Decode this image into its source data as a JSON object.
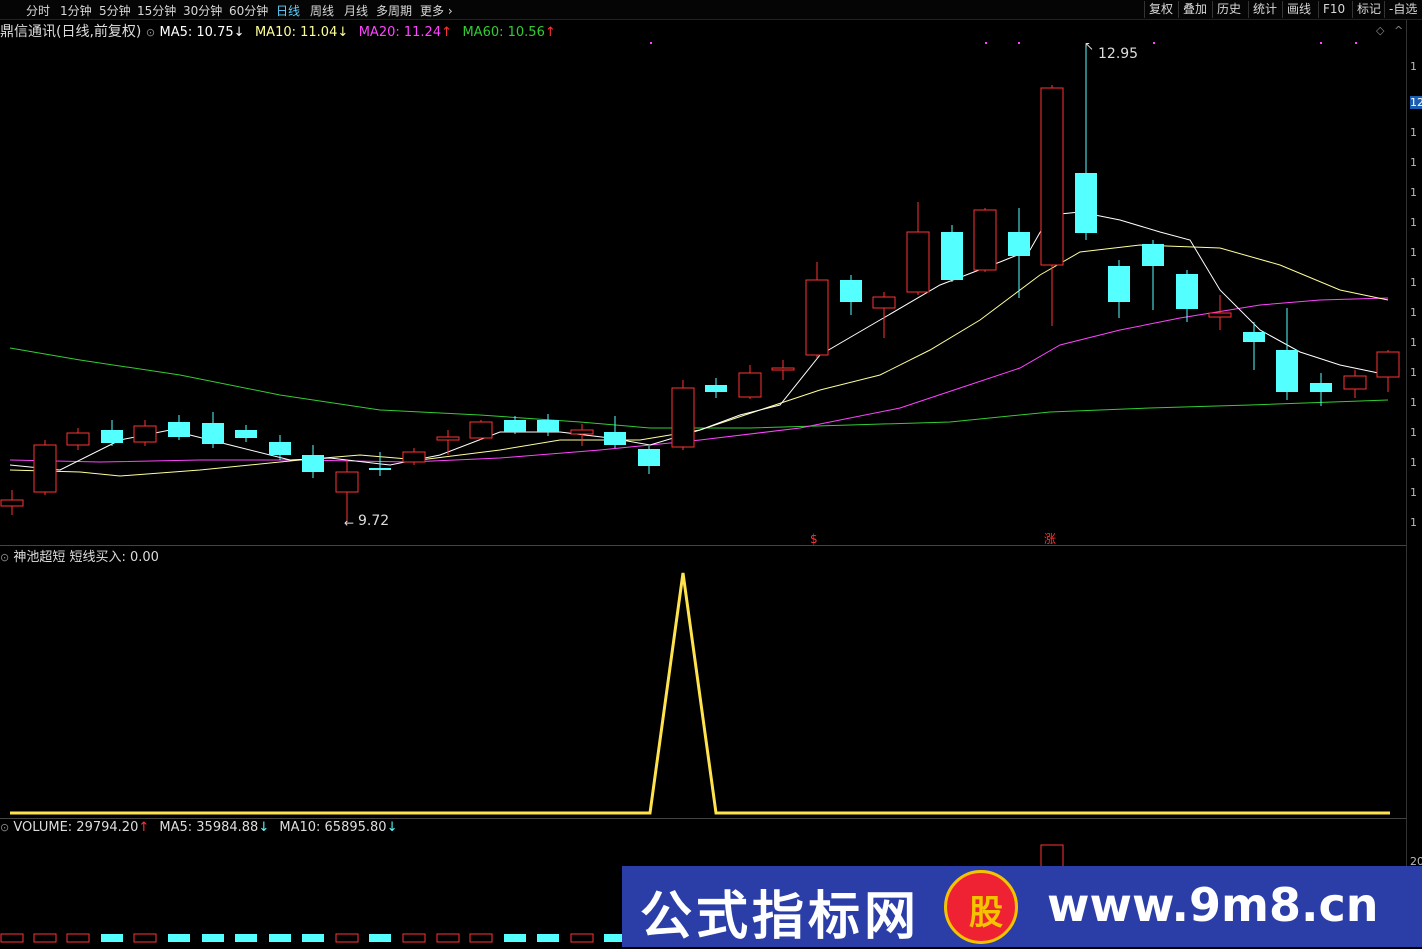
{
  "toolbar": {
    "tabs": [
      "分时",
      "1分钟",
      "5分钟",
      "15分钟",
      "30分钟",
      "60分钟",
      "日线",
      "周线",
      "月线",
      "多周期",
      "更多"
    ],
    "active_tab": "日线",
    "right_buttons": [
      "复权",
      "叠加",
      "历史",
      "统计",
      "画线",
      "F10",
      "标记",
      "-自选"
    ]
  },
  "main_chart": {
    "stock_title": "鼎信通讯(日线,前复权)",
    "ma5": {
      "label": "MA5: 10.75",
      "arrow": "↓",
      "color": "#ffffff"
    },
    "ma10": {
      "label": "MA10: 11.04",
      "arrow": "↓",
      "color": "#ffff99"
    },
    "ma20": {
      "label": "MA20: 11.24",
      "arrow": "↑",
      "color": "#ff44ff"
    },
    "ma60": {
      "label": "MA60: 10.56",
      "arrow": "↑",
      "color": "#33cc33"
    },
    "high_marker": "12.95",
    "low_marker": "9.72",
    "signal_marks": [
      "$",
      "涨"
    ]
  },
  "indicator_panel": {
    "title": "神池超短 短线买入: 0.00",
    "line_color": "#ffe34d"
  },
  "volume_panel": {
    "vol": {
      "label": "VOLUME: 29794.20",
      "arrow": "↑"
    },
    "ma5": {
      "label": "MA5: 35984.88",
      "arrow": "↓"
    },
    "ma10": {
      "label": "MA10: 65895.80",
      "arrow": "↓"
    }
  },
  "right_scale": {
    "ticks": [
      "1",
      "12",
      "1",
      "1",
      "1",
      "1",
      "1",
      "1",
      "1",
      "1",
      "1",
      "1",
      "1",
      "1",
      "1",
      "1"
    ],
    "highlight": "12",
    "vol_tick": "20"
  },
  "colors": {
    "up": "#ff3333",
    "down": "#54ffff",
    "bg": "#000000",
    "ma60": "#33cc33"
  },
  "watermark": {
    "text": "公式指标网",
    "url": "www.9m8.cn",
    "logo_text": "股"
  }
}
